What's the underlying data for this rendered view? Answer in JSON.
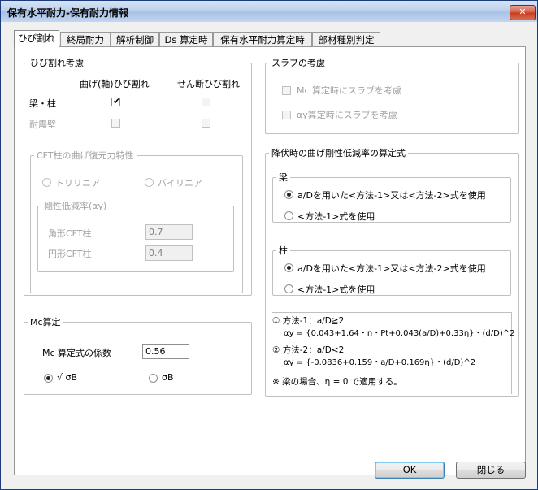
{
  "window": {
    "title": "保有水平耐力-保有耐力情報",
    "close_glyph": "✕"
  },
  "tabs": [
    "ひび割れ",
    "終局耐力",
    "解析制御",
    "Ds 算定時",
    "保有水平耐力算定時",
    "部材種別判定"
  ],
  "crack": {
    "legend": "ひび割れ考慮",
    "col_bending": "曲げ(軸)ひび割れ",
    "col_shear": "せん断ひび割れ",
    "row_beam_column": "梁・柱",
    "row_wall": "耐震壁",
    "beam_bending_checked": true,
    "beam_shear_checked": false,
    "wall_bending_checked": false,
    "wall_shear_checked": false,
    "cft": {
      "legend": "CFT柱の曲げ復元力特性",
      "opt_trilinear": "トリリニア",
      "opt_bilinear": "バイリニア",
      "stiffness": {
        "legend": "剛性低減率(αy)",
        "square_label": "角形CFT柱",
        "square_value": "0.7",
        "round_label": "円形CFT柱",
        "round_value": "0.4"
      }
    }
  },
  "mc": {
    "legend": "Mc算定",
    "coef_label": "Mc 算定式の係数",
    "coef_value": "0.56",
    "opt_sqrt": "√ σB",
    "opt_sigma": "σB",
    "selected": "sqrt"
  },
  "slab": {
    "legend": "スラブの考慮",
    "mc_label": "Mc 算定時にスラブを考慮",
    "ay_label": "αy算定時にスラブを考慮"
  },
  "yield": {
    "legend": "降伏時の曲げ剛性低減率の算定式",
    "beam": {
      "legend": "梁",
      "opt1": "a/Dを用いた<方法-1>又は<方法-2>式を使用",
      "opt2": "<方法-1>式を使用",
      "selected": 1
    },
    "column": {
      "legend": "柱",
      "opt1": "a/Dを用いた<方法-1>又は<方法-2>式を使用",
      "opt2": "<方法-1>式を使用",
      "selected": 1
    },
    "notes": {
      "m1_title": "① 方法-1：a/D≧2",
      "m1_formula": "αy = {0.043+1.64・n・Pt+0.043(a/D)+0.33η}・(d/D)^2",
      "m2_title": "② 方法-2：a/D<2",
      "m2_formula": "αy = {-0.0836+0.159・a/D+0.169η}・(d/D)^2",
      "note": "※ 梁の場合、η = 0 で適用する。"
    }
  },
  "buttons": {
    "ok": "OK",
    "close": "閉じる"
  }
}
